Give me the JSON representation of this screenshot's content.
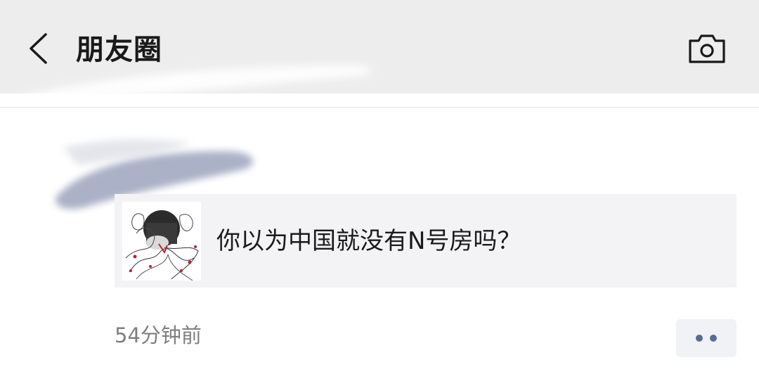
{
  "header": {
    "title": "朋友圈",
    "back_icon": "chevron-left-icon",
    "camera_icon": "camera-icon"
  },
  "post": {
    "link_card": {
      "title": "你以为中国就没有N号房吗？",
      "thumbnail": "sketch-illustration"
    },
    "time": "54分钟前",
    "more_icon": "more-dots-icon"
  },
  "colors": {
    "header_bg": "#ededed",
    "card_bg": "#f3f3f5",
    "link_blue": "#576b95",
    "time_gray": "#7f7f7f"
  }
}
